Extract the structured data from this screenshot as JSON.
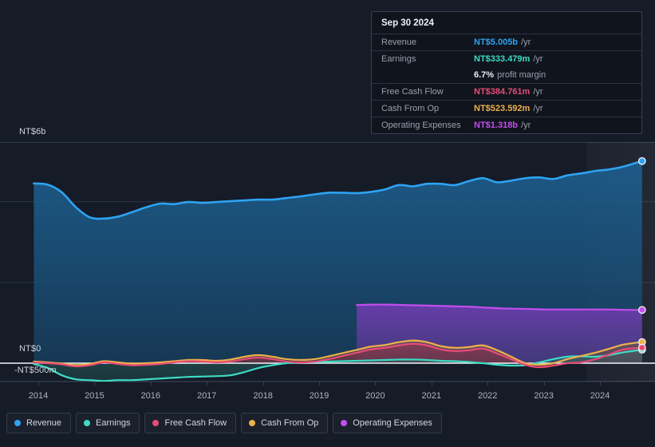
{
  "tooltip": {
    "date": "Sep 30 2024",
    "rows": [
      {
        "name": "Revenue",
        "value": "NT$5.005b",
        "unit": "/yr",
        "color": "#2ea3f2"
      },
      {
        "name": "Earnings",
        "value": "NT$333.479m",
        "unit": "/yr",
        "color": "#3ddbc4"
      },
      {
        "name": "",
        "value": "6.7%",
        "unit": "profit margin",
        "color": "#e9edf3"
      },
      {
        "name": "Free Cash Flow",
        "value": "NT$384.761m",
        "unit": "/yr",
        "color": "#e84a78"
      },
      {
        "name": "Cash From Op",
        "value": "NT$523.592m",
        "unit": "/yr",
        "color": "#eeb04a"
      },
      {
        "name": "Operating Expenses",
        "value": "NT$1.318b",
        "unit": "/yr",
        "color": "#c44df0"
      }
    ]
  },
  "axis": {
    "y_top_label": "NT$6b",
    "y_zero_label": "NT$0",
    "y_bottom_label": "-NT$500m",
    "x_ticks": [
      "2014",
      "2015",
      "2016",
      "2017",
      "2018",
      "2019",
      "2020",
      "2021",
      "2022",
      "2023",
      "2024"
    ]
  },
  "legend": {
    "items": [
      {
        "label": "Revenue",
        "color": "#2ea3f2"
      },
      {
        "label": "Earnings",
        "color": "#3ddbc4"
      },
      {
        "label": "Free Cash Flow",
        "color": "#e84a78"
      },
      {
        "label": "Cash From Op",
        "color": "#eeb04a"
      },
      {
        "label": "Operating Expenses",
        "color": "#c44df0"
      }
    ]
  },
  "chart_data": {
    "type": "area",
    "title": "",
    "xlabel": "",
    "ylabel": "NT$",
    "currency": "NT$",
    "ylim": [
      -0.5,
      6.5
    ],
    "xlim": [
      2013.9,
      2024.85
    ],
    "gridlines": [
      0,
      2,
      4
    ],
    "zero_line": 0,
    "grid": true,
    "legend_position": "bottom",
    "units": "billions NT$ (trailing twelve months)",
    "x": [
      2013.92,
      2014.17,
      2014.42,
      2014.67,
      2014.92,
      2015.17,
      2015.42,
      2015.67,
      2015.92,
      2016.17,
      2016.42,
      2016.67,
      2016.92,
      2017.17,
      2017.42,
      2017.67,
      2017.92,
      2018.17,
      2018.42,
      2018.67,
      2018.92,
      2019.17,
      2019.42,
      2019.67,
      2019.92,
      2020.17,
      2020.42,
      2020.67,
      2020.92,
      2021.17,
      2021.42,
      2021.67,
      2021.92,
      2022.17,
      2022.42,
      2022.67,
      2022.92,
      2023.17,
      2023.42,
      2023.67,
      2023.92,
      2024.17,
      2024.42,
      2024.75
    ],
    "series": [
      {
        "name": "Revenue",
        "color": "#2ea3f2",
        "values": [
          4.45,
          4.42,
          4.23,
          3.86,
          3.61,
          3.58,
          3.63,
          3.74,
          3.86,
          3.95,
          3.94,
          3.99,
          3.97,
          3.99,
          4.01,
          4.03,
          4.05,
          4.05,
          4.09,
          4.13,
          4.18,
          4.22,
          4.22,
          4.21,
          4.24,
          4.3,
          4.41,
          4.38,
          4.44,
          4.44,
          4.41,
          4.51,
          4.58,
          4.48,
          4.52,
          4.58,
          4.6,
          4.56,
          4.65,
          4.7,
          4.76,
          4.8,
          4.87,
          5.005
        ],
        "end_value": 5.005,
        "end_label": "NT$5.005b"
      },
      {
        "name": "Earnings",
        "color": "#3ddbc4",
        "values": [
          -0.02,
          -0.12,
          -0.3,
          -0.4,
          -0.42,
          -0.44,
          -0.42,
          -0.42,
          -0.4,
          -0.38,
          -0.36,
          -0.34,
          -0.33,
          -0.32,
          -0.3,
          -0.22,
          -0.12,
          -0.05,
          0.0,
          0.02,
          0.03,
          0.04,
          0.05,
          0.06,
          0.07,
          0.08,
          0.09,
          0.09,
          0.08,
          0.06,
          0.05,
          0.03,
          0.0,
          -0.04,
          -0.06,
          -0.05,
          0.02,
          0.1,
          0.16,
          0.17,
          0.16,
          0.2,
          0.27,
          0.333
        ],
        "end_value": 0.333,
        "end_label": "NT$333.479m"
      },
      {
        "name": "Free Cash Flow",
        "color": "#e84a78",
        "values": [
          0.02,
          0.0,
          -0.03,
          -0.08,
          -0.05,
          0.02,
          -0.02,
          -0.05,
          -0.04,
          -0.02,
          0.02,
          0.05,
          0.04,
          0.02,
          0.04,
          0.1,
          0.14,
          0.1,
          0.04,
          0.02,
          0.04,
          0.1,
          0.18,
          0.26,
          0.34,
          0.38,
          0.44,
          0.48,
          0.44,
          0.34,
          0.3,
          0.32,
          0.36,
          0.24,
          0.1,
          -0.04,
          -0.1,
          -0.06,
          0.0,
          0.02,
          0.1,
          0.22,
          0.34,
          0.385
        ],
        "end_value": 0.385,
        "end_label": "NT$384.761m"
      },
      {
        "name": "Cash From Op",
        "color": "#eeb04a",
        "values": [
          0.04,
          0.02,
          -0.01,
          -0.05,
          -0.02,
          0.05,
          0.02,
          -0.01,
          0.0,
          0.02,
          0.05,
          0.08,
          0.08,
          0.06,
          0.09,
          0.16,
          0.2,
          0.16,
          0.1,
          0.08,
          0.1,
          0.17,
          0.25,
          0.33,
          0.41,
          0.45,
          0.52,
          0.56,
          0.52,
          0.42,
          0.38,
          0.4,
          0.44,
          0.32,
          0.16,
          0.0,
          -0.04,
          0.0,
          0.1,
          0.18,
          0.26,
          0.36,
          0.46,
          0.524
        ],
        "end_value": 0.524,
        "end_label": "NT$523.592m"
      },
      {
        "name": "Operating Expenses",
        "color": "#c44df0",
        "start_x": 2019.67,
        "values": [
          1.44,
          1.45,
          1.45,
          1.44,
          1.43,
          1.42,
          1.41,
          1.4,
          1.38,
          1.36,
          1.35,
          1.34,
          1.33,
          1.33,
          1.33,
          1.33,
          1.33,
          1.32,
          1.318
        ],
        "end_value": 1.318,
        "end_label": "NT$1.318b"
      }
    ]
  }
}
